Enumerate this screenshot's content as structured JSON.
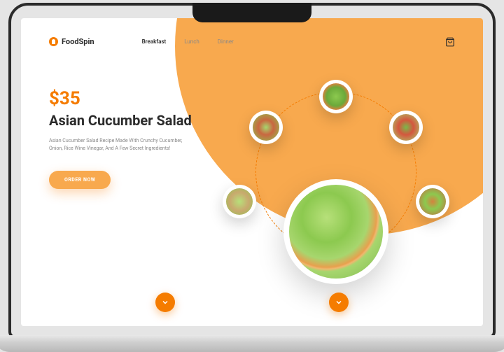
{
  "brand": "FoodSpin",
  "nav": {
    "items": [
      {
        "label": "Breakfast"
      },
      {
        "label": "Lunch"
      },
      {
        "label": "Dinner"
      }
    ],
    "active_index": 0
  },
  "product": {
    "price": "$35",
    "title": "Asian Cucumber Salad",
    "description": "Asian Cucumber Salad Recipe Made With Crunchy Cucumber, Onion, Rice Wine Vinegar, And A Few Secret Ingredients!",
    "cta": "ORDER NOW"
  },
  "colors": {
    "accent": "#f57c00",
    "accent_light": "#f8a94e"
  }
}
